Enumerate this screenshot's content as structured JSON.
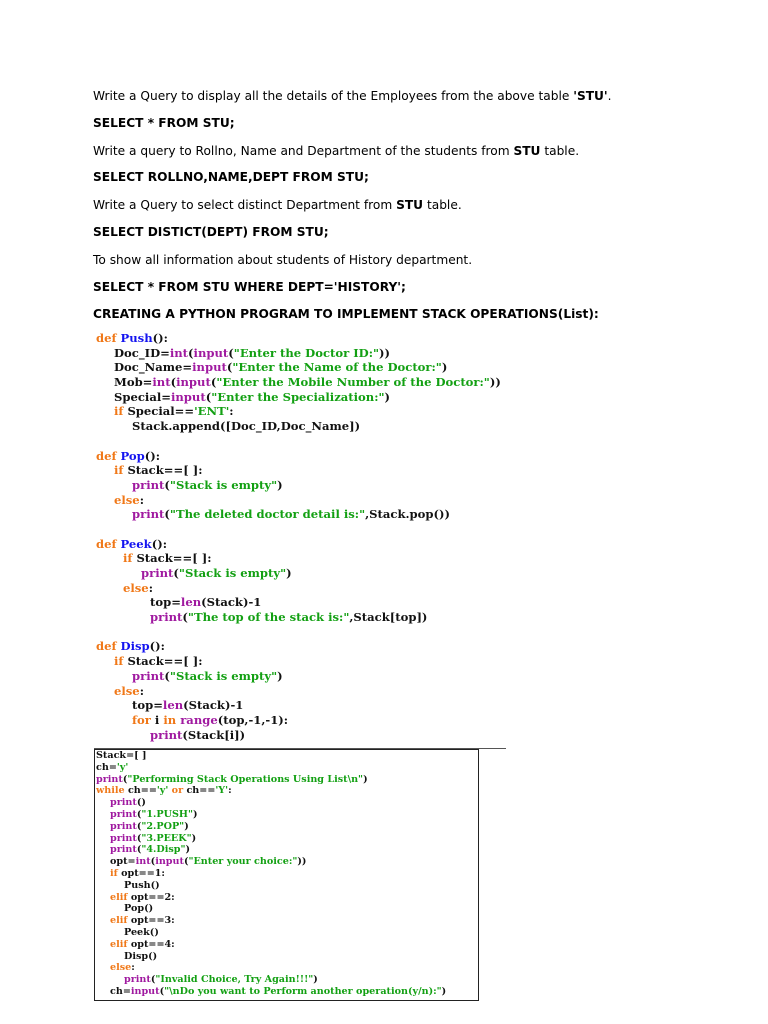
{
  "paragraphs": [
    {
      "parts": [
        "Write a Query to display all the details of the Employees from the above table ",
        "'STU'",
        "."
      ],
      "bold": [
        false,
        true,
        false
      ]
    },
    {
      "parts": [
        "SELECT * FROM STU;"
      ],
      "bold": [
        true
      ]
    },
    {
      "parts": [
        "Write a query to Rollno, Name and Department of the students from ",
        "STU",
        " table."
      ],
      "bold": [
        false,
        true,
        false
      ]
    },
    {
      "parts": [
        "SELECT ROLLNO,NAME,DEPT FROM STU;"
      ],
      "bold": [
        true
      ]
    },
    {
      "parts": [
        "Write a Query to select distinct Department from ",
        "STU",
        " table."
      ],
      "bold": [
        false,
        true,
        false
      ]
    },
    {
      "parts": [
        "SELECT DISTICT(DEPT) FROM STU;"
      ],
      "bold": [
        true
      ]
    },
    {
      "parts": [
        "To show all information about students of History department."
      ],
      "bold": [
        false
      ]
    },
    {
      "parts": [
        "SELECT * FROM STU WHERE DEPT='HISTORY';"
      ],
      "bold": [
        true
      ]
    },
    {
      "parts": [
        "CREATING A PYTHON PROGRAM TO IMPLEMENT STACK OPERATIONS(List):"
      ],
      "bold": [
        true
      ]
    }
  ],
  "code_functions": [
    {
      "i": 0,
      "t": [
        [
          "def ",
          "d"
        ],
        [
          "Push",
          "f"
        ],
        [
          "():",
          "n"
        ]
      ]
    },
    {
      "i": 2,
      "t": [
        [
          "Doc_ID=",
          "n"
        ],
        [
          "int",
          "b"
        ],
        [
          "(",
          "n"
        ],
        [
          "input",
          "b"
        ],
        [
          "(",
          "n"
        ],
        [
          "\"Enter the Doctor ID:\"",
          "s"
        ],
        [
          "))",
          "n"
        ]
      ]
    },
    {
      "i": 2,
      "t": [
        [
          "Doc_Name=",
          "n"
        ],
        [
          "input",
          "b"
        ],
        [
          "(",
          "n"
        ],
        [
          "\"Enter the Name of the Doctor:\"",
          "s"
        ],
        [
          ")",
          "n"
        ]
      ]
    },
    {
      "i": 2,
      "t": [
        [
          "Mob=",
          "n"
        ],
        [
          "int",
          "b"
        ],
        [
          "(",
          "n"
        ],
        [
          "input",
          "b"
        ],
        [
          "(",
          "n"
        ],
        [
          "\"Enter the Mobile Number of the Doctor:\"",
          "s"
        ],
        [
          "))",
          "n"
        ]
      ]
    },
    {
      "i": 2,
      "t": [
        [
          "Special=",
          "n"
        ],
        [
          "input",
          "b"
        ],
        [
          "(",
          "n"
        ],
        [
          "\"Enter the Specialization:\"",
          "s"
        ],
        [
          ")",
          "n"
        ]
      ]
    },
    {
      "i": 2,
      "t": [
        [
          "if ",
          "d"
        ],
        [
          "Special==",
          "n"
        ],
        [
          "'ENT'",
          "s"
        ],
        [
          ":",
          "n"
        ]
      ]
    },
    {
      "i": 4,
      "t": [
        [
          "Stack.append([Doc_ID,Doc_Name])",
          "n"
        ]
      ]
    },
    {
      "i": 0,
      "t": []
    },
    {
      "i": 0,
      "t": [
        [
          "def ",
          "d"
        ],
        [
          "Pop",
          "f"
        ],
        [
          "():",
          "n"
        ]
      ]
    },
    {
      "i": 2,
      "t": [
        [
          "if ",
          "d"
        ],
        [
          "Stack==[ ]:",
          "n"
        ]
      ]
    },
    {
      "i": 4,
      "t": [
        [
          "print",
          "b"
        ],
        [
          "(",
          "n"
        ],
        [
          "\"Stack is empty\"",
          "s"
        ],
        [
          ")",
          "n"
        ]
      ]
    },
    {
      "i": 2,
      "t": [
        [
          "else",
          "d"
        ],
        [
          ":",
          "n"
        ]
      ]
    },
    {
      "i": 4,
      "t": [
        [
          "print",
          "b"
        ],
        [
          "(",
          "n"
        ],
        [
          "\"The deleted doctor detail is:\"",
          "s"
        ],
        [
          ",Stack.pop())",
          "n"
        ]
      ]
    },
    {
      "i": 0,
      "t": []
    },
    {
      "i": 0,
      "t": [
        [
          "def ",
          "d"
        ],
        [
          "Peek",
          "f"
        ],
        [
          "():",
          "n"
        ]
      ]
    },
    {
      "i": 3,
      "t": [
        [
          "if ",
          "d"
        ],
        [
          "Stack==[ ]:",
          "n"
        ]
      ]
    },
    {
      "i": 5,
      "t": [
        [
          "print",
          "b"
        ],
        [
          "(",
          "n"
        ],
        [
          "\"Stack is empty\"",
          "s"
        ],
        [
          ")",
          "n"
        ]
      ]
    },
    {
      "i": 3,
      "t": [
        [
          "else",
          "d"
        ],
        [
          ":",
          "n"
        ]
      ]
    },
    {
      "i": 6,
      "t": [
        [
          "top=",
          "n"
        ],
        [
          "len",
          "b"
        ],
        [
          "(Stack)-1",
          "n"
        ]
      ]
    },
    {
      "i": 6,
      "t": [
        [
          "print",
          "b"
        ],
        [
          "(",
          "n"
        ],
        [
          "\"The top of the stack is:\"",
          "s"
        ],
        [
          ",Stack[top])",
          "n"
        ]
      ]
    },
    {
      "i": 0,
      "t": []
    },
    {
      "i": 0,
      "t": [
        [
          "def ",
          "d"
        ],
        [
          "Disp",
          "f"
        ],
        [
          "():",
          "n"
        ]
      ]
    },
    {
      "i": 2,
      "t": [
        [
          "if ",
          "d"
        ],
        [
          "Stack==[ ]:",
          "n"
        ]
      ]
    },
    {
      "i": 4,
      "t": [
        [
          "print",
          "b"
        ],
        [
          "(",
          "n"
        ],
        [
          "\"Stack is empty\"",
          "s"
        ],
        [
          ")",
          "n"
        ]
      ]
    },
    {
      "i": 2,
      "t": [
        [
          "else",
          "d"
        ],
        [
          ":",
          "n"
        ]
      ]
    },
    {
      "i": 4,
      "t": [
        [
          "top=",
          "n"
        ],
        [
          "len",
          "b"
        ],
        [
          "(Stack)-1",
          "n"
        ]
      ]
    },
    {
      "i": 4,
      "t": [
        [
          "for ",
          "d"
        ],
        [
          "i ",
          "n"
        ],
        [
          "in ",
          "d"
        ],
        [
          "range",
          "b"
        ],
        [
          "(top,-1,-1):",
          "n"
        ]
      ]
    },
    {
      "i": 6,
      "t": [
        [
          "print",
          "b"
        ],
        [
          "(Stack[i])",
          "n"
        ]
      ]
    }
  ],
  "code_main": [
    {
      "i": 0,
      "t": [
        [
          "Stack=[ ]",
          "n"
        ]
      ]
    },
    {
      "i": 0,
      "t": [
        [
          "ch=",
          "n"
        ],
        [
          "'y'",
          "s"
        ]
      ]
    },
    {
      "i": 0,
      "t": [
        [
          "print",
          "b"
        ],
        [
          "(",
          "n"
        ],
        [
          "\"Performing Stack Operations Using List\\n\"",
          "s"
        ],
        [
          ")",
          "n"
        ]
      ]
    },
    {
      "i": 0,
      "t": [
        [
          "while ",
          "d"
        ],
        [
          "ch==",
          "n"
        ],
        [
          "'y' ",
          "s"
        ],
        [
          "or ",
          "d"
        ],
        [
          "ch==",
          "n"
        ],
        [
          "'Y'",
          "s"
        ],
        [
          ":",
          "n"
        ]
      ]
    },
    {
      "i": 2,
      "t": [
        [
          "print",
          "b"
        ],
        [
          "()",
          "n"
        ]
      ]
    },
    {
      "i": 2,
      "t": [
        [
          "print",
          "b"
        ],
        [
          "(",
          "n"
        ],
        [
          "\"1.PUSH\"",
          "s"
        ],
        [
          ")",
          "n"
        ]
      ]
    },
    {
      "i": 2,
      "t": [
        [
          "print",
          "b"
        ],
        [
          "(",
          "n"
        ],
        [
          "\"2.POP\"",
          "s"
        ],
        [
          ")",
          "n"
        ]
      ]
    },
    {
      "i": 2,
      "t": [
        [
          "print",
          "b"
        ],
        [
          "(",
          "n"
        ],
        [
          "\"3.PEEK\"",
          "s"
        ],
        [
          ")",
          "n"
        ]
      ]
    },
    {
      "i": 2,
      "t": [
        [
          "print",
          "b"
        ],
        [
          "(",
          "n"
        ],
        [
          "\"4.Disp\"",
          "s"
        ],
        [
          ")",
          "n"
        ]
      ]
    },
    {
      "i": 2,
      "t": [
        [
          "opt=",
          "n"
        ],
        [
          "int",
          "b"
        ],
        [
          "(",
          "n"
        ],
        [
          "input",
          "b"
        ],
        [
          "(",
          "n"
        ],
        [
          "\"Enter your choice:\"",
          "s"
        ],
        [
          "))",
          "n"
        ]
      ]
    },
    {
      "i": 2,
      "t": [
        [
          "if ",
          "d"
        ],
        [
          "opt==1:",
          "n"
        ]
      ]
    },
    {
      "i": 4,
      "t": [
        [
          "Push()",
          "n"
        ]
      ]
    },
    {
      "i": 2,
      "t": [
        [
          "elif ",
          "d"
        ],
        [
          "opt==2:",
          "n"
        ]
      ]
    },
    {
      "i": 4,
      "t": [
        [
          "Pop()",
          "n"
        ]
      ]
    },
    {
      "i": 2,
      "t": [
        [
          "elif ",
          "d"
        ],
        [
          "opt==3:",
          "n"
        ]
      ]
    },
    {
      "i": 4,
      "t": [
        [
          "Peek()",
          "n"
        ]
      ]
    },
    {
      "i": 2,
      "t": [
        [
          "elif ",
          "d"
        ],
        [
          "opt==4:",
          "n"
        ]
      ]
    },
    {
      "i": 4,
      "t": [
        [
          "Disp()",
          "n"
        ]
      ]
    },
    {
      "i": 2,
      "t": [
        [
          "else",
          "d"
        ],
        [
          ":",
          "n"
        ]
      ]
    },
    {
      "i": 4,
      "t": [
        [
          "print",
          "b"
        ],
        [
          "(",
          "n"
        ],
        [
          "\"Invalid Choice, Try Again!!!\"",
          "s"
        ],
        [
          ")",
          "n"
        ]
      ]
    },
    {
      "i": 2,
      "t": [
        [
          "ch=",
          "n"
        ],
        [
          "input",
          "b"
        ],
        [
          "(",
          "n"
        ],
        [
          "\"\\nDo you want to Perform another operation(y/n):\"",
          "s"
        ],
        [
          ")",
          "n"
        ]
      ]
    }
  ]
}
